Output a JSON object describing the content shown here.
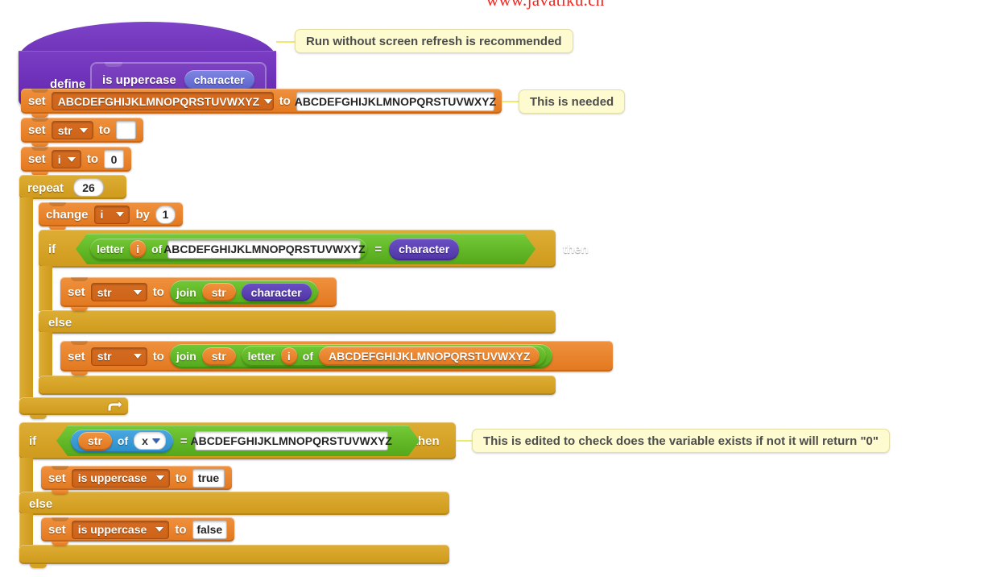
{
  "watermark": "www.javatiku.cn",
  "palette": {
    "variables_orange": "#e2781f",
    "control_gold": "#cf9a1c",
    "operators_green": "#54a81a",
    "sensing_blue": "#2b8ec9",
    "custom_purple": "#6327ae",
    "comment_yellow": "#fdfbcf",
    "watermark_red": "#f4261f"
  },
  "script": {
    "define": {
      "keyword": "define",
      "procedure_name": "is uppercase",
      "parameter": "character"
    },
    "comments": [
      {
        "id": "comment-run-without-refresh",
        "text": "Run without screen refresh is recommended"
      },
      {
        "id": "comment-this-is-needed",
        "text": "This is needed"
      },
      {
        "id": "comment-variable-exists",
        "text": "This is edited to check does the variable exists if not it will return \"0\""
      }
    ],
    "set_alphabet": {
      "keyword": "set",
      "variable": "ABCDEFGHIJKLMNOPQRSTUVWXYZ",
      "to": "to",
      "value": "ABCDEFGHIJKLMNOPQRSTUVWXYZ"
    },
    "set_str": {
      "keyword": "set",
      "variable": "str",
      "to": "to",
      "value": ""
    },
    "set_i": {
      "keyword": "set",
      "variable": "i",
      "to": "to",
      "value": "0"
    },
    "repeat": {
      "keyword": "repeat",
      "times": "26"
    },
    "change_i": {
      "keyword": "change",
      "variable": "i",
      "by": "by",
      "value": "1"
    },
    "if_letter": {
      "if": "if",
      "then": "then",
      "else": "else",
      "condition": {
        "left": {
          "keyword": "letter",
          "index": "i",
          "of": "of",
          "string": "ABCDEFGHIJKLMNOPQRSTUVWXYZ"
        },
        "operator": "=",
        "right": "character"
      },
      "then_body": {
        "keyword": "set",
        "variable": "str",
        "to": "to",
        "join": "join",
        "arg1": "str",
        "arg2": "character"
      },
      "else_body": {
        "keyword": "set",
        "variable": "str",
        "to": "to",
        "join": "join",
        "arg1": "str",
        "letter": "letter",
        "index": "i",
        "of": "of",
        "string": "ABCDEFGHIJKLMNOPQRSTUVWXYZ"
      }
    },
    "if_check": {
      "if": "if",
      "then": "then",
      "else": "else",
      "condition": {
        "left": {
          "property": "str",
          "of": "of",
          "target": "x"
        },
        "operator": "=",
        "right": "ABCDEFGHIJKLMNOPQRSTUVWXYZ"
      },
      "then_body": {
        "keyword": "set",
        "variable": "is uppercase",
        "to": "to",
        "value": "true"
      },
      "else_body": {
        "keyword": "set",
        "variable": "is uppercase",
        "to": "to",
        "value": "false"
      }
    }
  }
}
